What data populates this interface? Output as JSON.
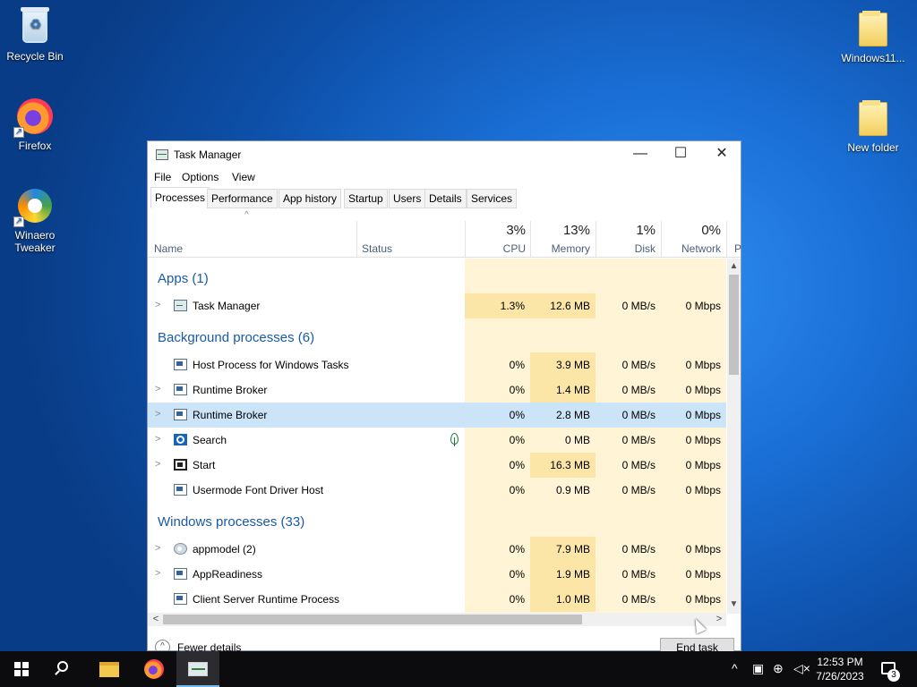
{
  "desktop": {
    "icons": [
      {
        "label": "Recycle Bin",
        "icon": "recycle-bin-icon"
      },
      {
        "label": "Firefox",
        "icon": "firefox-icon"
      },
      {
        "label": "Winaero Tweaker",
        "icon": "winaero-tweaker-icon"
      },
      {
        "label": "Windows11...",
        "icon": "folder-icon"
      },
      {
        "label": "New folder",
        "icon": "folder-icon"
      }
    ]
  },
  "window": {
    "title": "Task Manager",
    "controls": {
      "minimize": "—",
      "maximize": "☐",
      "close": "✕"
    },
    "menu": [
      "File",
      "Options",
      "View"
    ],
    "tabs": [
      "Processes",
      "Performance",
      "App history",
      "Startup",
      "Users",
      "Details",
      "Services"
    ],
    "active_tab": "Processes"
  },
  "columns": {
    "name": "Name",
    "status": "Status",
    "cpu": {
      "pct": "3%",
      "label": "CPU"
    },
    "memory": {
      "pct": "13%",
      "label": "Memory"
    },
    "disk": {
      "pct": "1%",
      "label": "Disk"
    },
    "network": {
      "pct": "0%",
      "label": "Network"
    },
    "power": "P"
  },
  "groups": {
    "apps": "Apps (1)",
    "background": "Background processes (6)",
    "windows": "Windows processes (33)"
  },
  "processes": [
    {
      "name": "Task Manager",
      "cpu": "1.3%",
      "memory": "12.6 MB",
      "disk": "0 MB/s",
      "network": "0 Mbps"
    },
    {
      "name": "Host Process for Windows Tasks",
      "cpu": "0%",
      "memory": "3.9 MB",
      "disk": "0 MB/s",
      "network": "0 Mbps"
    },
    {
      "name": "Runtime Broker",
      "cpu": "0%",
      "memory": "1.4 MB",
      "disk": "0 MB/s",
      "network": "0 Mbps"
    },
    {
      "name": "Runtime Broker",
      "cpu": "0%",
      "memory": "2.8 MB",
      "disk": "0 MB/s",
      "network": "0 Mbps"
    },
    {
      "name": "Search",
      "cpu": "0%",
      "memory": "0 MB",
      "disk": "0 MB/s",
      "network": "0 Mbps"
    },
    {
      "name": "Start",
      "cpu": "0%",
      "memory": "16.3 MB",
      "disk": "0 MB/s",
      "network": "0 Mbps"
    },
    {
      "name": "Usermode Font Driver Host",
      "cpu": "0%",
      "memory": "0.9 MB",
      "disk": "0 MB/s",
      "network": "0 Mbps"
    },
    {
      "name": "appmodel (2)",
      "cpu": "0%",
      "memory": "7.9 MB",
      "disk": "0 MB/s",
      "network": "0 Mbps"
    },
    {
      "name": "AppReadiness",
      "cpu": "0%",
      "memory": "1.9 MB",
      "disk": "0 MB/s",
      "network": "0 Mbps"
    },
    {
      "name": "Client Server Runtime Process",
      "cpu": "0%",
      "memory": "1.0 MB",
      "disk": "0 MB/s",
      "network": "0 Mbps"
    }
  ],
  "footer": {
    "fewer_details": "Fewer details",
    "end_task": "End task"
  },
  "taskbar": {
    "items": [
      "start-icon",
      "search-icon",
      "file-explorer-icon",
      "firefox-icon",
      "task-manager-icon"
    ],
    "tray": {
      "chevron": "^",
      "notification_count": "3"
    },
    "time": "12:53 PM",
    "date": "7/26/2023"
  }
}
